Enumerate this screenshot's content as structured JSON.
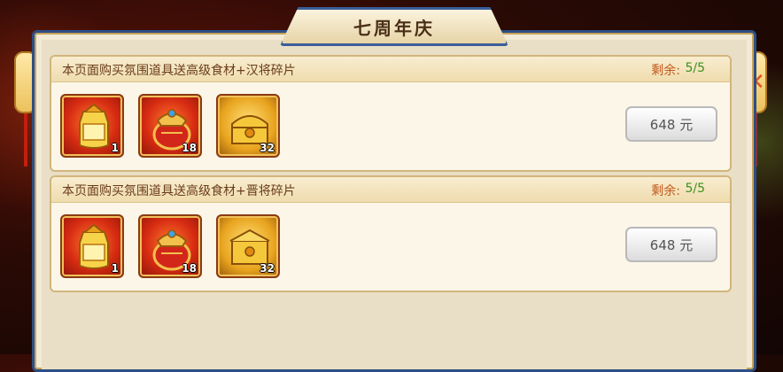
{
  "title": "七周年庆",
  "close_icon": "close-icon",
  "offers": [
    {
      "description": "本页面购买氛围道具送高级食材+汉将碎片",
      "remain_label": "剩余:",
      "remain_value": "5/5",
      "price_label": "648 元",
      "items": [
        {
          "icon": "red-treasure-bag",
          "quantity": "1"
        },
        {
          "icon": "red-gold-pouch",
          "quantity": "18"
        },
        {
          "icon": "golden-chest",
          "quantity": "32"
        }
      ]
    },
    {
      "description": "本页面购买氛围道具送高级食材+晋将碎片",
      "remain_label": "剩余:",
      "remain_value": "5/5",
      "price_label": "648 元",
      "items": [
        {
          "icon": "red-treasure-bag",
          "quantity": "1"
        },
        {
          "icon": "red-gold-pouch",
          "quantity": "18"
        },
        {
          "icon": "golden-chest",
          "quantity": "32"
        }
      ]
    }
  ],
  "colors": {
    "panel_border": "#2d4e86",
    "remain_label": "#c2571a",
    "remain_value": "#3f8f1e",
    "close_icon": "#e0561c"
  }
}
